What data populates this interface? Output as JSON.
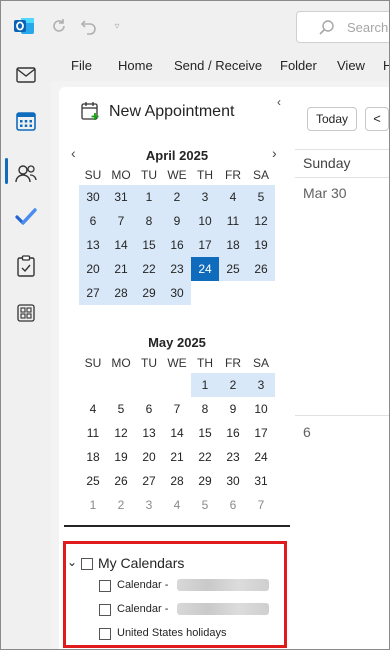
{
  "title_bar": {
    "search_label": "Search"
  },
  "rail": {
    "items": [
      "mail-icon",
      "calendar-icon",
      "people-icon",
      "todo-icon",
      "tasks-icon",
      "apps-icon"
    ],
    "active": "calendar-icon"
  },
  "menu": {
    "items": [
      "File",
      "Home",
      "Send / Receive",
      "Folder",
      "View",
      "H"
    ]
  },
  "nav_pane": {
    "new_appointment": "New Appointment",
    "april": {
      "title": "April 2025",
      "day_headers": [
        "SU",
        "MO",
        "TU",
        "WE",
        "TH",
        "FR",
        "SA"
      ],
      "weeks": [
        [
          "30",
          "31",
          "1",
          "2",
          "3",
          "4",
          "5"
        ],
        [
          "6",
          "7",
          "8",
          "9",
          "10",
          "11",
          "12"
        ],
        [
          "13",
          "14",
          "15",
          "16",
          "17",
          "18",
          "19"
        ],
        [
          "20",
          "21",
          "22",
          "23",
          "24",
          "25",
          "26"
        ],
        [
          "27",
          "28",
          "29",
          "30",
          "",
          "",
          ""
        ]
      ],
      "today": "24"
    },
    "may": {
      "title": "May 2025",
      "day_headers": [
        "SU",
        "MO",
        "TU",
        "WE",
        "TH",
        "FR",
        "SA"
      ],
      "weeks": [
        [
          "",
          "",
          "",
          "",
          "1",
          "2",
          "3"
        ],
        [
          "4",
          "5",
          "6",
          "7",
          "8",
          "9",
          "10"
        ],
        [
          "11",
          "12",
          "13",
          "14",
          "15",
          "16",
          "17"
        ],
        [
          "18",
          "19",
          "20",
          "21",
          "22",
          "23",
          "24"
        ],
        [
          "25",
          "26",
          "27",
          "28",
          "29",
          "30",
          "31"
        ],
        [
          "1",
          "2",
          "3",
          "4",
          "5",
          "6",
          "7"
        ]
      ]
    },
    "my_calendars": {
      "group_label": "My Calendars",
      "items": [
        "Calendar -",
        "Calendar -",
        "United States holidays"
      ]
    }
  },
  "calendar_view": {
    "today_button": "Today",
    "prev_button": "<",
    "day_header": "Sunday",
    "first_date": "Mar 30",
    "second_date": "6"
  },
  "colors": {
    "accent": "#0f6cbd",
    "range_highlight": "#d9e8f8",
    "annotation_box": "#e01b1b"
  }
}
